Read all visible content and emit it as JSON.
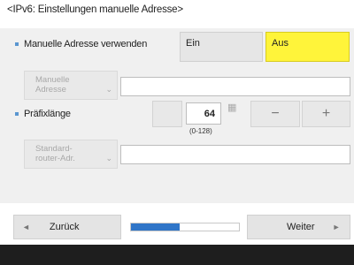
{
  "title": "<IPv6: Einstellungen manuelle Adresse>",
  "manual_address": {
    "label": "Manuelle Adresse verwenden",
    "options": [
      {
        "label": "Ein",
        "selected": false
      },
      {
        "label": "Aus",
        "selected": true
      }
    ]
  },
  "manual_address_field": {
    "label_line1": "Manuelle",
    "label_line2": "Adresse",
    "value": ""
  },
  "prefix_length": {
    "label": "Präfixlänge",
    "value": "64",
    "range": "(0-128)",
    "minus": "−",
    "plus": "+"
  },
  "gateway_field": {
    "label_line1": "Standard-",
    "label_line2": "router-Adr.",
    "value": ""
  },
  "navigation": {
    "back_label": "Zurück",
    "next_label": "Weiter",
    "progress": 0.45
  },
  "colors": {
    "selected": "#fff43a",
    "accent": "#2f75c8",
    "bullet": "#5a96d0"
  }
}
